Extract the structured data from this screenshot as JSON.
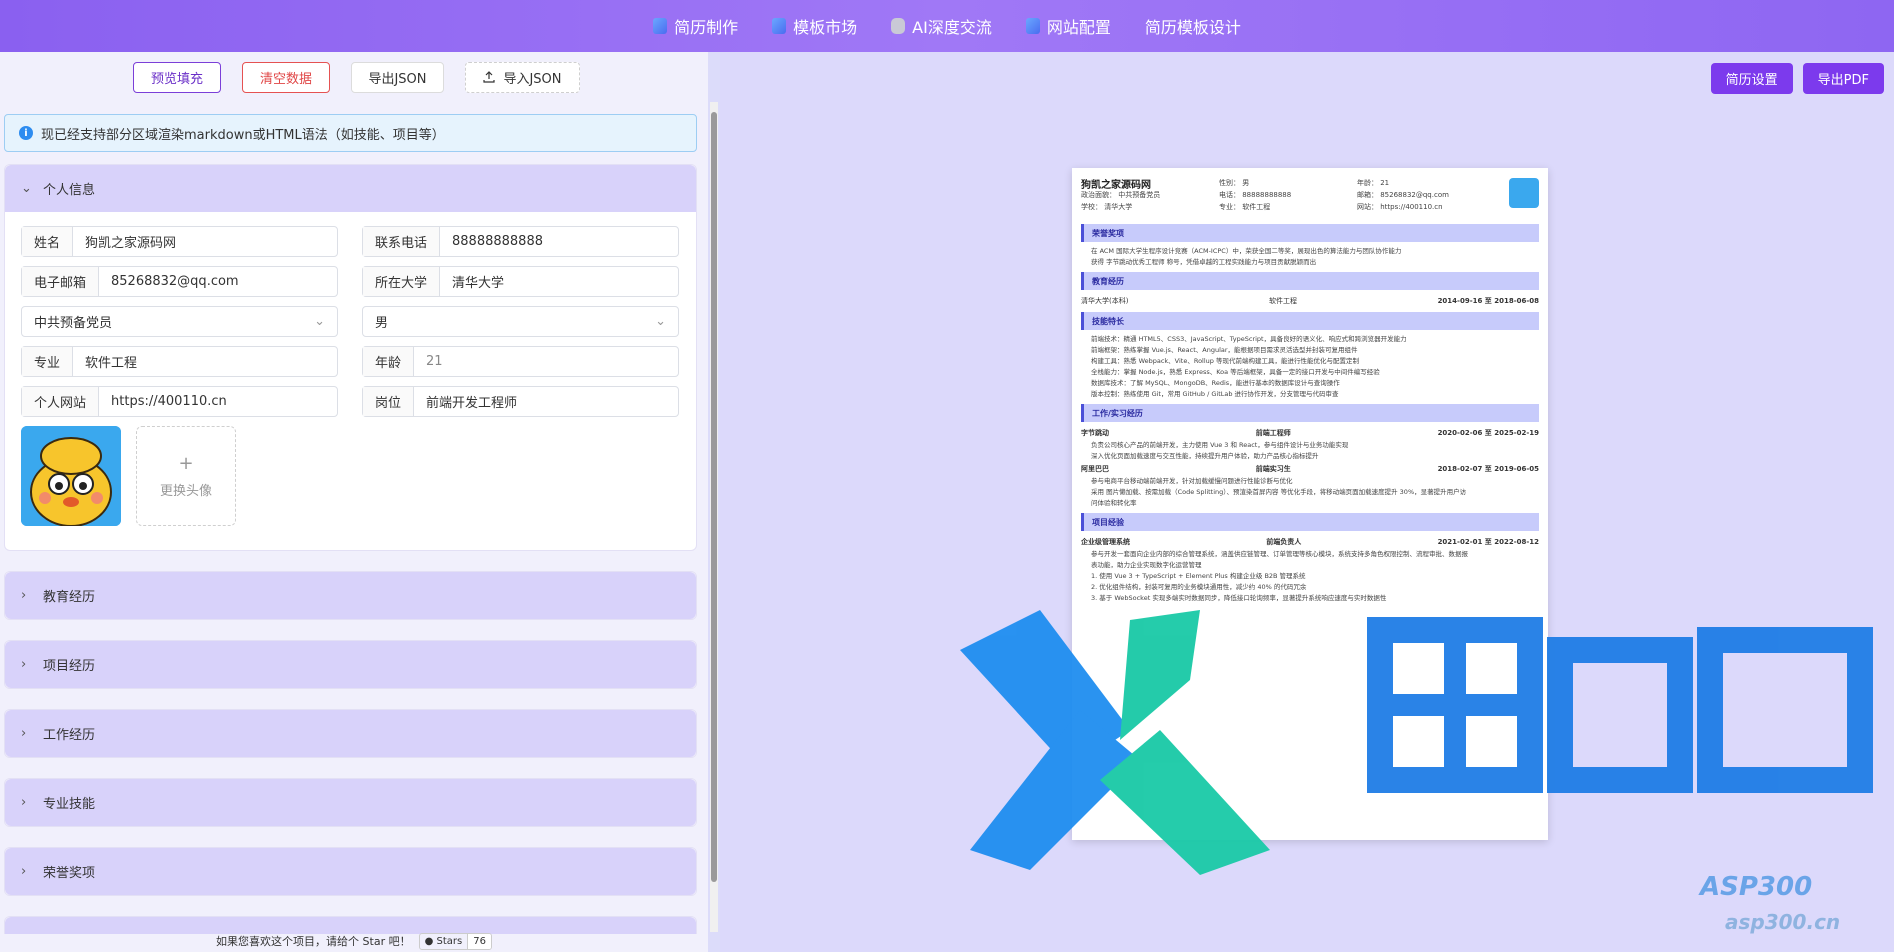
{
  "nav": {
    "items": [
      {
        "label": "简历制作",
        "icon": "document-icon"
      },
      {
        "label": "模板市场",
        "icon": "grid-icon"
      },
      {
        "label": "AI深度交流",
        "icon": "robot-icon"
      },
      {
        "label": "网站配置",
        "icon": "settings-doc-icon"
      },
      {
        "label": "简历模板设计",
        "icon": ""
      }
    ]
  },
  "toolbar": {
    "preview_label": "预览填充",
    "clear_label": "清空数据",
    "export_label": "导出JSON",
    "import_label": "导入JSON"
  },
  "alert": {
    "text": "现已经支持部分区域渲染markdown或HTML语法（如技能、项目等）"
  },
  "personal": {
    "title": "个人信息",
    "name_label": "姓名",
    "name_value": "狗凯之家源码网",
    "phone_label": "联系电话",
    "phone_value": "88888888888",
    "email_label": "电子邮箱",
    "email_value": "85268832@qq.com",
    "school_label": "所在大学",
    "school_value": "清华大学",
    "politics_value": "中共预备党员",
    "gender_value": "男",
    "major_label": "专业",
    "major_value": "软件工程",
    "age_label": "年龄",
    "age_value": "21",
    "site_label": "个人网站",
    "site_value": "https://400110.cn",
    "job_label": "岗位",
    "job_value": "前端开发工程师",
    "avatar_change": "更换头像"
  },
  "sections": [
    "教育经历",
    "项目经历",
    "工作经历",
    "专业技能",
    "荣誉奖项"
  ],
  "footer": {
    "text": "如果您喜欢这个项目，请给个 Star 吧！",
    "stars_label": "Stars",
    "stars_count": "76"
  },
  "right_toolbar": {
    "settings_label": "简历设置",
    "pdf_label": "导出PDF"
  },
  "resume": {
    "name": "狗凯之家源码网",
    "politics": "政治面貌：  中共预备党员",
    "school": "学校：    清华大学",
    "gender": "性别：    男",
    "phone": "电话：    88888888888",
    "major": "专业：    软件工程",
    "age": "年龄：    21",
    "email": "邮箱：    85268832@qq.com",
    "site": "网站：    https://400110.cn",
    "sec_honor": "荣誉奖项",
    "honor1": "在 ACM 国际大学生程序设计竞赛（ACM-ICPC）中，荣获全国二等奖，展现出色的算法能力与团队协作能力",
    "honor2": "获得 字节跳动优秀工程师 称号，凭借卓越的工程实践能力与项目贡献脱颖而出",
    "sec_edu": "教育经历",
    "edu_school": "清华大学(本科)",
    "edu_major": "软件工程",
    "edu_date": "2014-09-16 至 2018-06-08",
    "sec_skill": "技能特长",
    "skill1": "前端技术：精通 HTML5、CSS3、JavaScript、TypeScript，具备良好的语义化、响应式和跨浏览器开发能力",
    "skill2": "前端框架：熟练掌握 Vue.js、React、Angular，能根据项目需求灵活选型并封装可复用组件",
    "skill3": "构建工具：熟悉 Webpack、Vite、Rollup 等现代前端构建工具，能进行性能优化与配置定制",
    "skill4": "全栈能力：掌握 Node.js，熟悉 Express、Koa 等后端框架，具备一定的接口开发与中间件编写经验",
    "skill5": "数据库技术：了解 MySQL、MongoDB、Redis，能进行基本的数据库设计与查询操作",
    "skill6": "版本控制：熟练使用 Git，常用 GitHub / GitLab 进行协作开发，分支管理与代码审查",
    "sec_work": "工作/实习经历",
    "work1_company": "字节跳动",
    "work1_role": "前端工程师",
    "work1_date": "2020-02-06 至 2025-02-19",
    "work1_l1": "负责公司核心产品的前端开发，主力使用 Vue 3 和 React，参与组件设计与业务功能实现",
    "work1_l2": "深入优化页面加载速度与交互性能，持续提升用户体验，助力产品核心指标提升",
    "work2_company": "阿里巴巴",
    "work2_role": "前端实习生",
    "work2_date": "2018-02-07 至 2019-06-05",
    "work2_l1": "参与电商平台移动端前端开发，针对加载缓慢问题进行性能诊断与优化",
    "work2_l2": "采用 图片懒加载、按需加载（Code Splitting）、预渲染首屏内容 等优化手段，将移动端页面加载速度提升 30%，显著提升用户访",
    "work2_l3": "问体验和转化率",
    "sec_proj": "项目经验",
    "proj1_name": "企业级管理系统",
    "proj1_role": "前端负责人",
    "proj1_date": "2021-02-01 至 2022-08-12",
    "proj1_l1": "参与开发一套面向企业内部的综合管理系统，涵盖供应链管理、订单管理等核心模块，系统支持多角色权限控制、流程审批、数据报",
    "proj1_l2": "表功能，助力企业实现数字化运营管理",
    "proj1_l3": "1. 使用 Vue 3 + TypeScript + Element Plus 构建企业级 B2B 管理系统",
    "proj1_l4": "2. 优化组件结构，封装可复用的业务模块通用性，减少约 40% 的代码冗余",
    "proj1_l5": "3. 基于 WebSocket 实现多端实时数据同步，降低接口轮询频率，显著提升系统响应速度与实时数据性"
  }
}
